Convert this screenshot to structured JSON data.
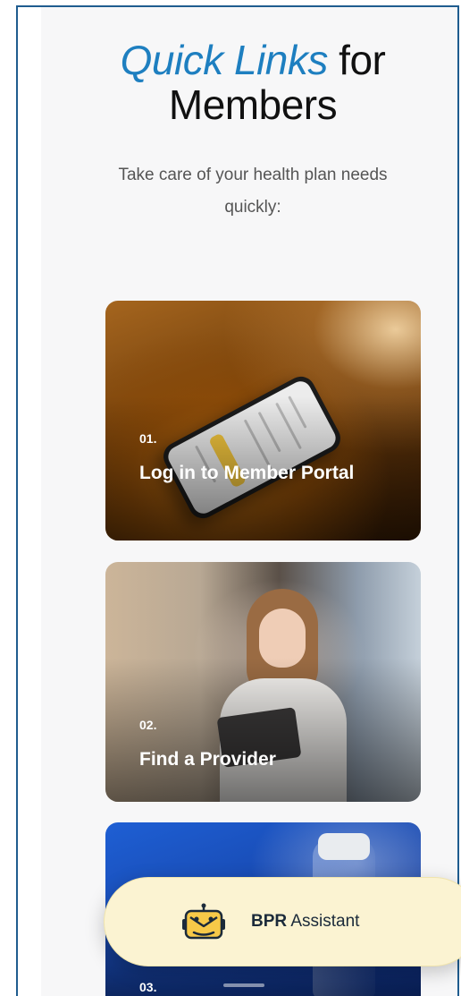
{
  "header": {
    "title_accent": "Quick Links",
    "title_rest": " for",
    "title_line2": "Members",
    "subtitle": "Take care of your health plan needs quickly:"
  },
  "cards": [
    {
      "number": "01.",
      "title": "Log in to Member Portal"
    },
    {
      "number": "02.",
      "title": "Find a Provider"
    },
    {
      "number": "03."
    }
  ],
  "assistant": {
    "brand": "BPR",
    "label": " Assistant"
  },
  "icons": {
    "assistant_icon": "robot-chat-icon"
  },
  "colors": {
    "accent": "#1e7fc0",
    "frame_border": "#1f5c8f",
    "assistant_bg": "#fbf3d2",
    "bot_yellow": "#f7c948"
  }
}
